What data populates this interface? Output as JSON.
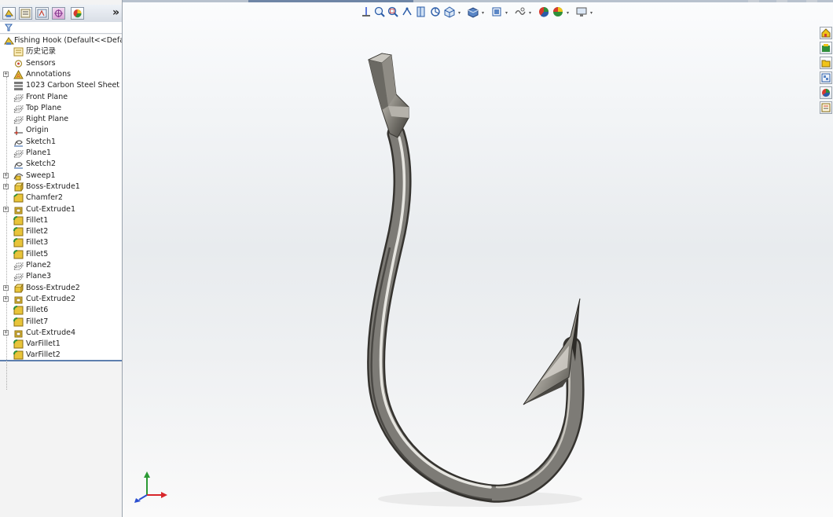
{
  "feature_manager": {
    "tabs": [
      {
        "name": "featuremanager-tab"
      },
      {
        "name": "propertymanager-tab"
      },
      {
        "name": "configurationmanager-tab"
      },
      {
        "name": "dimxpert-tab"
      },
      {
        "name": "display-manager-tab"
      }
    ],
    "more_label": "»",
    "tree": [
      {
        "label": "Fishing Hook  (Default<<Defa",
        "icon": "part-icon",
        "expander": ""
      },
      {
        "label": "历史记录",
        "icon": "history-icon",
        "expander": ""
      },
      {
        "label": "Sensors",
        "icon": "sensors-icon",
        "expander": ""
      },
      {
        "label": "Annotations",
        "icon": "annotations-icon",
        "expander": "+"
      },
      {
        "label": "1023 Carbon Steel Sheet (",
        "icon": "material-icon",
        "expander": ""
      },
      {
        "label": "Front Plane",
        "icon": "plane-icon",
        "expander": ""
      },
      {
        "label": "Top Plane",
        "icon": "plane-icon",
        "expander": ""
      },
      {
        "label": "Right Plane",
        "icon": "plane-icon",
        "expander": ""
      },
      {
        "label": "Origin",
        "icon": "origin-icon",
        "expander": ""
      },
      {
        "label": "Sketch1",
        "icon": "sketch-icon",
        "expander": ""
      },
      {
        "label": "Plane1",
        "icon": "plane-icon",
        "expander": ""
      },
      {
        "label": "Sketch2",
        "icon": "sketch-icon",
        "expander": ""
      },
      {
        "label": "Sweep1",
        "icon": "sweep-icon",
        "expander": "+"
      },
      {
        "label": "Boss-Extrude1",
        "icon": "boss-extrude-icon",
        "expander": "+"
      },
      {
        "label": "Chamfer2",
        "icon": "chamfer-icon",
        "expander": ""
      },
      {
        "label": "Cut-Extrude1",
        "icon": "cut-extrude-icon",
        "expander": "+"
      },
      {
        "label": "Fillet1",
        "icon": "fillet-icon",
        "expander": ""
      },
      {
        "label": "Fillet2",
        "icon": "fillet-icon",
        "expander": ""
      },
      {
        "label": "Fillet3",
        "icon": "fillet-icon",
        "expander": ""
      },
      {
        "label": "Fillet5",
        "icon": "fillet-icon",
        "expander": ""
      },
      {
        "label": "Plane2",
        "icon": "plane-icon",
        "expander": ""
      },
      {
        "label": "Plane3",
        "icon": "plane-icon",
        "expander": ""
      },
      {
        "label": "Boss-Extrude2",
        "icon": "boss-extrude-icon",
        "expander": "+"
      },
      {
        "label": "Cut-Extrude2",
        "icon": "cut-extrude-icon",
        "expander": "+"
      },
      {
        "label": "Fillet6",
        "icon": "fillet-icon",
        "expander": ""
      },
      {
        "label": "Fillet7",
        "icon": "fillet-icon",
        "expander": ""
      },
      {
        "label": "Cut-Extrude4",
        "icon": "cut-extrude-icon",
        "expander": "+"
      },
      {
        "label": "VarFillet1",
        "icon": "fillet-icon",
        "expander": ""
      },
      {
        "label": "VarFillet2",
        "icon": "fillet-icon",
        "expander": ""
      }
    ]
  },
  "heads_up_toolbar": [
    "view-orientation-icon",
    "zoom-to-fit-icon",
    "zoom-to-area-icon",
    "previous-view-icon",
    "section-view-icon",
    "dynamic-annotation-icon",
    "view-orientation-dropdown-icon",
    "display-style-icon",
    "hide-show-items-icon",
    "edit-appearance-icon",
    "apply-scene-icon",
    "view-settings-icon"
  ],
  "task_pane": [
    "solidworks-resources-icon",
    "design-library-icon",
    "file-explorer-icon",
    "view-palette-icon",
    "appearances-scenes-icon",
    "custom-properties-icon"
  ],
  "colors": {
    "tree_highlight": "#5d7fae",
    "hook_steel": "#7d7b76",
    "axis_x": "#d8262b",
    "axis_y": "#2c9a34",
    "axis_z": "#2b4fd0"
  }
}
